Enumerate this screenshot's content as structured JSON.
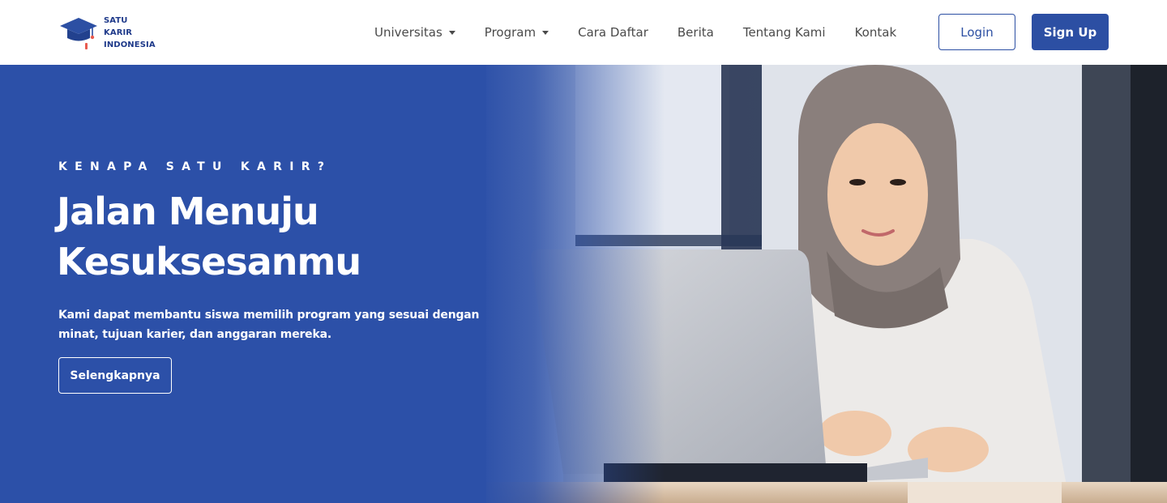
{
  "brand": {
    "line1": "SATU",
    "line2": "KARIR",
    "line3": "INDONESIA",
    "logo_icon": "graduation-cap-icon"
  },
  "nav": {
    "items": [
      {
        "label": "Universitas",
        "has_dropdown": true
      },
      {
        "label": "Program",
        "has_dropdown": true
      },
      {
        "label": "Cara Daftar",
        "has_dropdown": false
      },
      {
        "label": "Berita",
        "has_dropdown": false
      },
      {
        "label": "Tentang Kami",
        "has_dropdown": false
      },
      {
        "label": "Kontak",
        "has_dropdown": false
      }
    ],
    "login_label": "Login",
    "signup_label": "Sign Up"
  },
  "hero": {
    "eyebrow": "KENAPA SATU KARIR?",
    "headline_line1": "Jalan Menuju",
    "headline_line2": "Kesuksesanmu",
    "description": "Kami dapat membantu siswa memilih program yang sesuai dengan minat, tujuan karier, dan anggaran mereka.",
    "cta_label": "Selengkapnya"
  },
  "colors": {
    "primary": "#2c4fa3",
    "hero_background": "#2c50a8",
    "brand_text": "#1f3a8a",
    "nav_text": "#4a4a4a",
    "white": "#ffffff"
  }
}
